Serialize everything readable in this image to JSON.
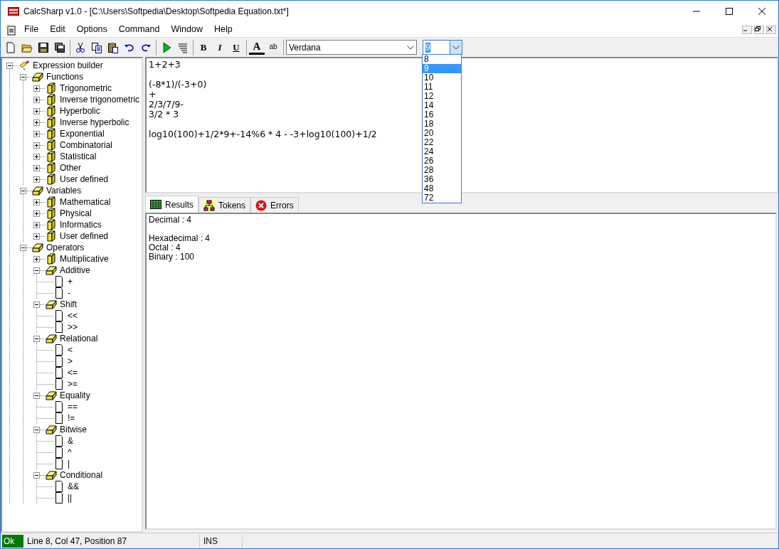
{
  "window": {
    "title": "CalcSharp v1.0 - [C:\\Users\\Softpedia\\Desktop\\Softpedia Equation.txt*]"
  },
  "menu": [
    "File",
    "Edit",
    "Options",
    "Command",
    "Window",
    "Help"
  ],
  "toolbar": [
    {
      "kind": "new"
    },
    {
      "kind": "open"
    },
    {
      "kind": "save"
    },
    {
      "kind": "save-all"
    },
    {
      "kind": "sep"
    },
    {
      "kind": "cut"
    },
    {
      "kind": "copy"
    },
    {
      "kind": "paste"
    },
    {
      "kind": "undo"
    },
    {
      "kind": "redo"
    },
    {
      "kind": "sep"
    },
    {
      "kind": "run"
    },
    {
      "kind": "format"
    },
    {
      "kind": "sep"
    },
    {
      "kind": "bold",
      "label": "B"
    },
    {
      "kind": "italic",
      "label": "I"
    },
    {
      "kind": "underline",
      "label": "U"
    },
    {
      "kind": "sep"
    },
    {
      "kind": "font-color",
      "label": "A"
    },
    {
      "kind": "highlight",
      "label": "ab"
    },
    {
      "kind": "sep"
    }
  ],
  "font_combo": {
    "value": "Verdana"
  },
  "size_combo": {
    "value": "9",
    "expanded": true,
    "options": [
      {
        "label": "8",
        "selected": false
      },
      {
        "label": "9",
        "selected": true
      },
      {
        "label": "10",
        "selected": false
      },
      {
        "label": "11",
        "selected": false
      },
      {
        "label": "12",
        "selected": false
      },
      {
        "label": "14",
        "selected": false
      },
      {
        "label": "16",
        "selected": false
      },
      {
        "label": "18",
        "selected": false
      },
      {
        "label": "20",
        "selected": false
      },
      {
        "label": "22",
        "selected": false
      },
      {
        "label": "24",
        "selected": false
      },
      {
        "label": "26",
        "selected": false
      },
      {
        "label": "28",
        "selected": false
      },
      {
        "label": "36",
        "selected": false
      },
      {
        "label": "48",
        "selected": false
      },
      {
        "label": "72",
        "selected": false
      }
    ]
  },
  "tree": [
    {
      "label": "Expression builder",
      "kind": "root",
      "expanded": true,
      "children": [
        {
          "label": "Functions",
          "kind": "group",
          "expanded": true,
          "children": [
            {
              "label": "Trigonometric",
              "kind": "folder",
              "expanded": false
            },
            {
              "label": "Inverse trigonometric",
              "kind": "folder",
              "expanded": false
            },
            {
              "label": "Hyperbolic",
              "kind": "folder",
              "expanded": false
            },
            {
              "label": "Inverse hyperbolic",
              "kind": "folder",
              "expanded": false
            },
            {
              "label": "Exponential",
              "kind": "folder",
              "expanded": false
            },
            {
              "label": "Combinatorial",
              "kind": "folder",
              "expanded": false
            },
            {
              "label": "Statistical",
              "kind": "folder",
              "expanded": false
            },
            {
              "label": "Other",
              "kind": "folder",
              "expanded": false
            },
            {
              "label": "User defined",
              "kind": "folder",
              "expanded": false
            }
          ]
        },
        {
          "label": "Variables",
          "kind": "group",
          "expanded": true,
          "children": [
            {
              "label": "Mathematical",
              "kind": "folder",
              "expanded": false
            },
            {
              "label": "Physical",
              "kind": "folder",
              "expanded": false
            },
            {
              "label": "Informatics",
              "kind": "folder",
              "expanded": false
            },
            {
              "label": "User defined",
              "kind": "folder",
              "expanded": false
            }
          ]
        },
        {
          "label": "Operators",
          "kind": "group",
          "expanded": true,
          "children": [
            {
              "label": "Multiplicative",
              "kind": "folder",
              "expanded": false
            },
            {
              "label": "Additive",
              "kind": "group",
              "expanded": true,
              "children": [
                {
                  "label": "+",
                  "kind": "leaf"
                },
                {
                  "label": "-",
                  "kind": "leaf"
                }
              ]
            },
            {
              "label": "Shift",
              "kind": "group",
              "expanded": true,
              "children": [
                {
                  "label": "<<",
                  "kind": "leaf"
                },
                {
                  "label": ">>",
                  "kind": "leaf"
                }
              ]
            },
            {
              "label": "Relational",
              "kind": "group",
              "expanded": true,
              "children": [
                {
                  "label": "<",
                  "kind": "leaf"
                },
                {
                  "label": ">",
                  "kind": "leaf"
                },
                {
                  "label": "<=",
                  "kind": "leaf"
                },
                {
                  "label": ">=",
                  "kind": "leaf"
                }
              ]
            },
            {
              "label": "Equality",
              "kind": "group",
              "expanded": true,
              "children": [
                {
                  "label": "==",
                  "kind": "leaf"
                },
                {
                  "label": "!=",
                  "kind": "leaf"
                }
              ]
            },
            {
              "label": "Bitwise",
              "kind": "group",
              "expanded": true,
              "children": [
                {
                  "label": "&",
                  "kind": "leaf"
                },
                {
                  "label": "^",
                  "kind": "leaf"
                },
                {
                  "label": "|",
                  "kind": "leaf"
                }
              ]
            },
            {
              "label": "Conditional",
              "kind": "group",
              "expanded": true,
              "children": [
                {
                  "label": "&&",
                  "kind": "leaf"
                },
                {
                  "label": "||",
                  "kind": "leaf"
                }
              ]
            }
          ]
        }
      ]
    }
  ],
  "editor": {
    "paragraphs": [
      [
        "1+2+3"
      ],
      [
        "(-8*1)/(-3+0)",
        "+",
        "2/3/7/9-",
        "3/2 * 3"
      ],
      [
        "log10(100)+1/2*9+-14%6 * 4 - -3+log10(100)+1/2"
      ]
    ]
  },
  "tabs": [
    {
      "label": "Results",
      "kind": "results",
      "selected": true
    },
    {
      "label": "Tokens",
      "kind": "tokens",
      "selected": false
    },
    {
      "label": "Errors",
      "kind": "errors",
      "selected": false
    }
  ],
  "results": {
    "paragraphs": [
      [
        "Decimal : 4"
      ],
      [
        "Hexadecimal : 4",
        "Octal : 4",
        "Binary : 100"
      ]
    ]
  },
  "status_bar": {
    "state": "Ok",
    "position": "Line 8, Col 47, Position 87",
    "mode": "INS"
  }
}
